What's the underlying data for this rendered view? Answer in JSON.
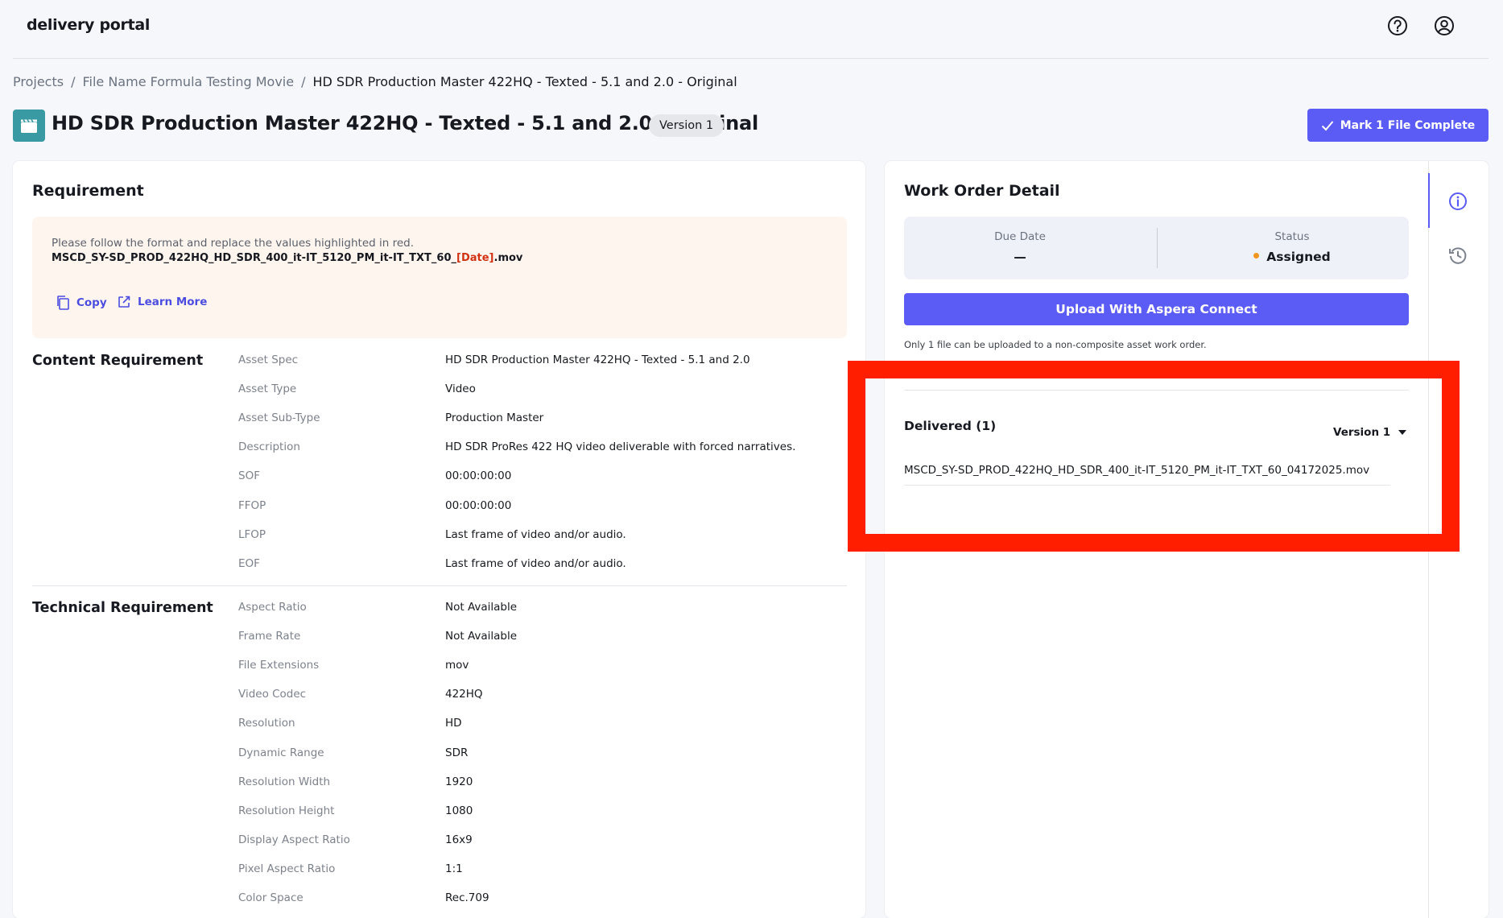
{
  "app": {
    "logo": "delivery portal"
  },
  "header": {
    "icons": [
      "help-icon",
      "user-account-icon"
    ]
  },
  "breadcrumb": {
    "items": [
      "Projects",
      "File Name Formula Testing Movie",
      "HD SDR Production Master 422HQ - Texted - 5.1 and 2.0 - Original"
    ],
    "separator": "/"
  },
  "page": {
    "title": "HD SDR Production Master 422HQ - Texted - 5.1 and 2.0 - Original",
    "version_badge": "Version 1",
    "mark_complete_label": "Mark 1 File Complete",
    "title_icon": "clapperboard-icon"
  },
  "requirement": {
    "title": "Requirement",
    "hint": "Please follow the format and replace the values highlighted in red.",
    "formula_prefix": "MSCD_SY-SD_PROD_422HQ_HD_SDR_400_it-IT_5120_PM_it-IT_TXT_60_",
    "formula_highlight": "[Date]",
    "formula_suffix": ".mov",
    "copy_label": "Copy",
    "learn_more_label": "Learn More"
  },
  "content_requirement": {
    "title": "Content Requirement",
    "rows": [
      {
        "label": "Asset Spec",
        "value": "HD SDR Production Master 422HQ - Texted - 5.1 and 2.0"
      },
      {
        "label": "Asset Type",
        "value": "Video"
      },
      {
        "label": "Asset Sub-Type",
        "value": "Production Master"
      },
      {
        "label": "Description",
        "value": "HD SDR ProRes 422 HQ video deliverable with forced narratives."
      },
      {
        "label": "SOF",
        "value": "00:00:00:00"
      },
      {
        "label": "FFOP",
        "value": "00:00:00:00"
      },
      {
        "label": "LFOP",
        "value": "Last frame of video and/or audio."
      },
      {
        "label": "EOF",
        "value": "Last frame of video and/or audio."
      }
    ]
  },
  "technical_requirement": {
    "title": "Technical Requirement",
    "rows": [
      {
        "label": "Aspect Ratio",
        "value": "Not Available"
      },
      {
        "label": "Frame Rate",
        "value": "Not Available"
      },
      {
        "label": "File Extensions",
        "value": "mov"
      },
      {
        "label": "Video Codec",
        "value": "422HQ"
      },
      {
        "label": "Resolution",
        "value": "HD"
      },
      {
        "label": "Dynamic Range",
        "value": "SDR"
      },
      {
        "label": "Resolution Width",
        "value": "1920"
      },
      {
        "label": "Resolution Height",
        "value": "1080"
      },
      {
        "label": "Display Aspect Ratio",
        "value": "16x9"
      },
      {
        "label": "Pixel Aspect Ratio",
        "value": "1:1"
      },
      {
        "label": "Color Space",
        "value": "Rec.709"
      }
    ]
  },
  "work_order": {
    "title": "Work Order Detail",
    "due_date_label": "Due Date",
    "due_date_value": "—",
    "status_label": "Status",
    "status_value": "Assigned",
    "status_color": "#f0961e",
    "upload_label": "Upload With Aspera Connect",
    "upload_note": "Only 1 file can be uploaded to a non-composite asset work order.",
    "delivered_label": "Delivered (1)",
    "version_select": "Version 1",
    "delivered_file": "MSCD_SY-SD_PROD_422HQ_HD_SDR_400_it-IT_5120_PM_it-IT_TXT_60_04172025.mov"
  },
  "side_rail": {
    "icons": [
      "info-icon",
      "history-icon"
    ]
  },
  "colors": {
    "accent": "#5b5cf6",
    "highlight_frame": "#ff1f00",
    "formula_red": "#d13212"
  }
}
